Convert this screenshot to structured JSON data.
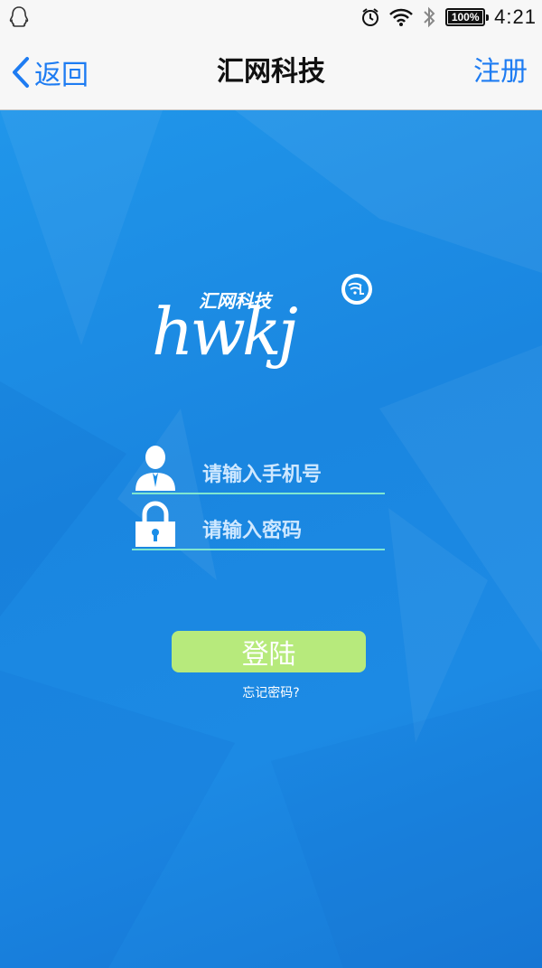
{
  "status_bar": {
    "time": "4:21",
    "battery_label": "100%",
    "battery_level": 1.0,
    "icons": [
      "qq-icon",
      "alarm-icon",
      "wifi-icon",
      "bluetooth-icon",
      "battery-icon"
    ]
  },
  "nav": {
    "back_label": "返回",
    "title": "汇网科技",
    "register_label": "注册"
  },
  "logo": {
    "cn_text": "汇网科技",
    "latin_text": "hwkj"
  },
  "form": {
    "phone_placeholder": "请输入手机号",
    "password_placeholder": "请输入密码",
    "phone_value": "",
    "password_value": ""
  },
  "actions": {
    "login_label": "登陆",
    "forgot_label": "忘记密码?"
  },
  "colors": {
    "accent": "#1e7cf2",
    "background": "#1a8ee8",
    "login_button": "#b7ea7c",
    "field_underline": "#7fe6d0"
  }
}
